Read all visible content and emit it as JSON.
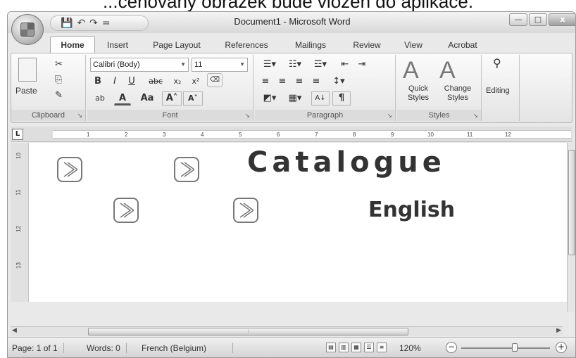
{
  "caption": "...čenovaný obrázek bude vložen do aplikace.",
  "window": {
    "title": "Document1 - Microsoft Word",
    "quick_access": [
      "💾",
      "↶",
      "↷",
      "="
    ],
    "controls": [
      "—",
      "□",
      "x"
    ]
  },
  "tabs": [
    "Home",
    "Insert",
    "Page Layout",
    "References",
    "Mailings",
    "Review",
    "View",
    "Acrobat"
  ],
  "active_tab": "Home",
  "ribbon": {
    "clipboard": {
      "label": "Clipboard",
      "paste": "Paste"
    },
    "font": {
      "label": "Font",
      "family": "Calibri (Body)",
      "size": "11",
      "bold": "B",
      "italic": "I",
      "underline": "U",
      "strike": "abc",
      "subscript": "x₂",
      "superscript": "x²",
      "grow": "A˄",
      "shrink": "A˅",
      "change_case": "Aa",
      "highlight": "ab",
      "font_color": "A"
    },
    "paragraph": {
      "label": "Paragraph",
      "pilcrow": "¶",
      "sort": "A↓"
    },
    "styles": {
      "label": "Styles",
      "quick": "Quick\nStyles",
      "change": "Change\nStyles"
    },
    "editing": {
      "label": "Editing"
    }
  },
  "ruler": {
    "corner": "L",
    "numbers": [
      "1",
      "2",
      "3",
      "4",
      "5",
      "6",
      "7",
      "8",
      "9",
      "10",
      "11",
      "12"
    ]
  },
  "vruler_numbers": [
    "10",
    "11",
    "12",
    "13"
  ],
  "document": {
    "title": "Catalogue",
    "subtitle": "English"
  },
  "status": {
    "page": "Page: 1 of 1",
    "words": "Words: 0",
    "language": "French (Belgium)",
    "zoom": "120%",
    "zoom_level": 0.6
  }
}
